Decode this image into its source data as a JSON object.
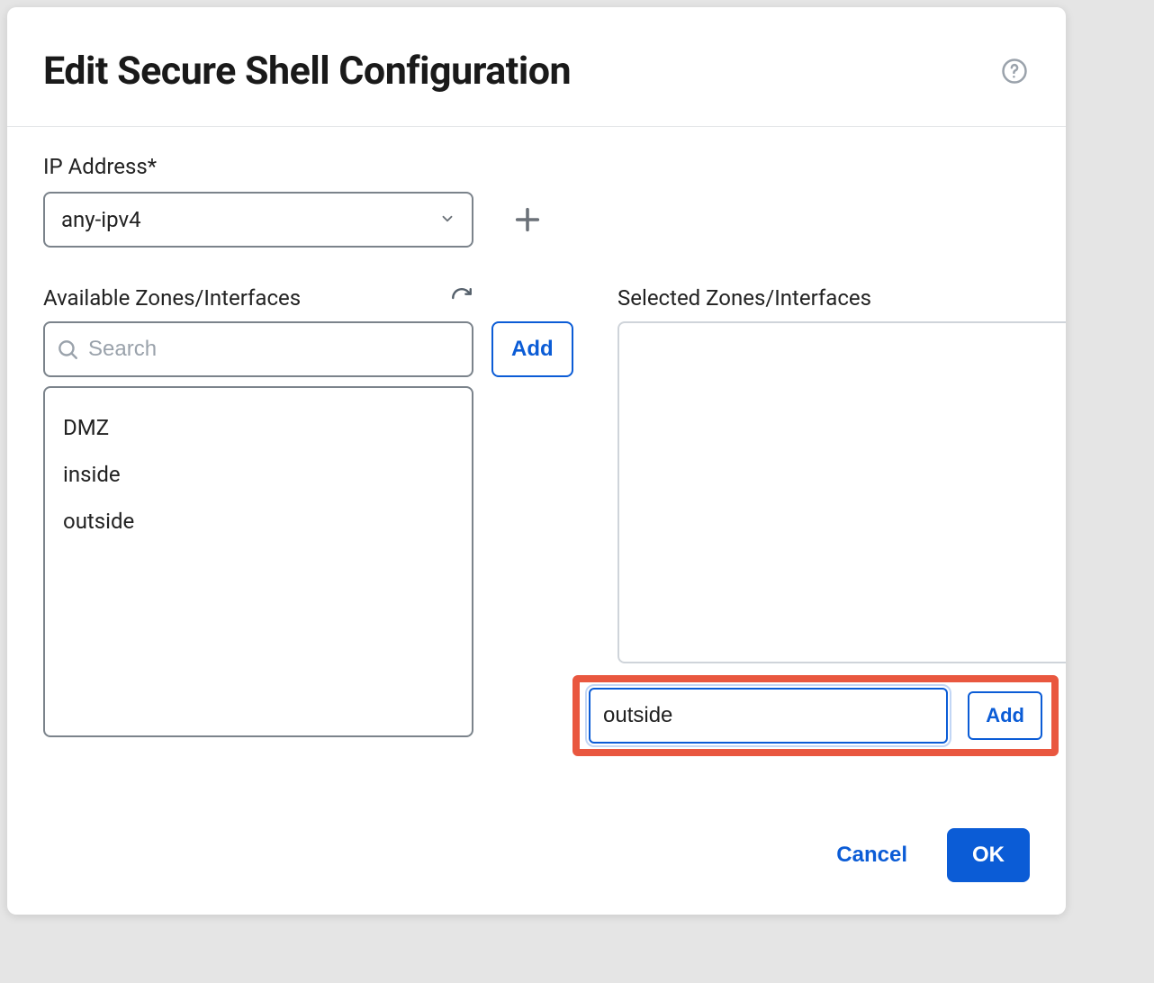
{
  "dialog": {
    "title": "Edit Secure Shell Configuration"
  },
  "ip": {
    "label": "IP Address*",
    "value": "any-ipv4"
  },
  "available": {
    "label": "Available Zones/Interfaces",
    "search_placeholder": "Search",
    "add_button": "Add",
    "items": [
      "DMZ",
      "inside",
      "outside"
    ]
  },
  "selected": {
    "label": "Selected Zones/Interfaces",
    "manual_value": "outside",
    "add_button": "Add"
  },
  "footer": {
    "cancel": "Cancel",
    "ok": "OK"
  }
}
